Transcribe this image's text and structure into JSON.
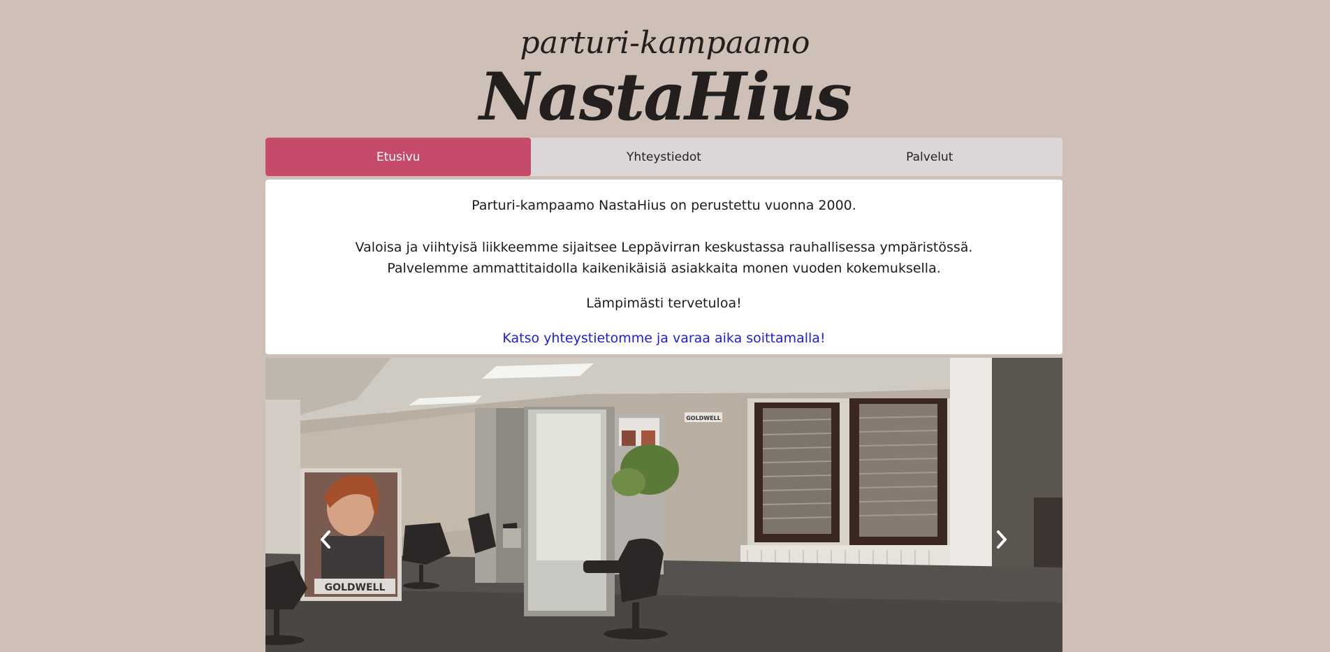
{
  "header": {
    "logo_subtitle": "parturi-kampaamo",
    "logo_title": "NastaHius"
  },
  "nav": {
    "tabs": [
      {
        "label": "Etusivu",
        "active": true
      },
      {
        "label": "Yhteystiedot",
        "active": false
      },
      {
        "label": "Palvelut",
        "active": false
      }
    ]
  },
  "content": {
    "intro": "Parturi-kampaamo NastaHius on perustettu vuonna 2000.",
    "line1": "Valoisa ja viihtyisä liikkeemme sijaitsee Leppävirran keskustassa rauhallisessa ympäristössä.",
    "line2": "Palvelemme ammattitaidolla kaikenikäisiä asiakkaita monen vuoden kokemuksella.",
    "welcome": "Lämpimästi tervetuloa!",
    "cta_link": "Katso yhteystietomme ja varaa aika soittamalla!"
  },
  "carousel": {
    "prev_icon": "chevron-left-icon",
    "next_icon": "chevron-right-icon",
    "photo": "salon-interior-photo",
    "poster_text_1": "GOLDWELL",
    "poster_text_2": "GOLDWELL"
  },
  "colors": {
    "page_background": "#cec0b6",
    "accent": "#c64a6a",
    "nav_background": "#dbd7d6",
    "link": "#1c1ce0"
  }
}
